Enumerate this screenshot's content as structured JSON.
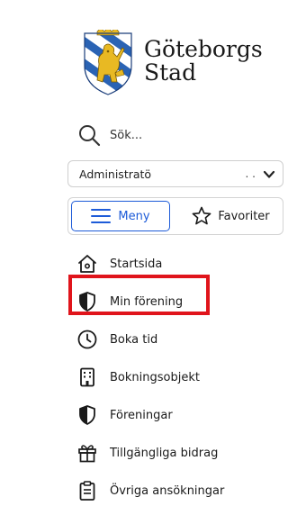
{
  "logo": {
    "line1": "Göteborgs",
    "line2": "Stad"
  },
  "search": {
    "label": "Sök..."
  },
  "role_select": {
    "value": "Administratö",
    "extra": ". ."
  },
  "tabs": [
    {
      "label": "Meny",
      "icon": "hamburger-icon",
      "active": true
    },
    {
      "label": "Favoriter",
      "icon": "star-icon",
      "active": false
    }
  ],
  "menu": [
    {
      "label": "Startsida",
      "icon": "home-icon"
    },
    {
      "label": "Min förening",
      "icon": "shield-icon",
      "highlighted": true
    },
    {
      "label": "Boka tid",
      "icon": "clock-icon"
    },
    {
      "label": "Bokningsobjekt",
      "icon": "building-icon"
    },
    {
      "label": "Föreningar",
      "icon": "shield-icon"
    },
    {
      "label": "Tillgängliga bidrag",
      "icon": "gift-icon"
    },
    {
      "label": "Övriga ansökningar",
      "icon": "clipboard-icon"
    }
  ],
  "colors": {
    "accent": "#1d5bd8",
    "highlight": "#e0141b",
    "crest_blue": "#2a63b4",
    "crest_gold": "#e8b923"
  }
}
